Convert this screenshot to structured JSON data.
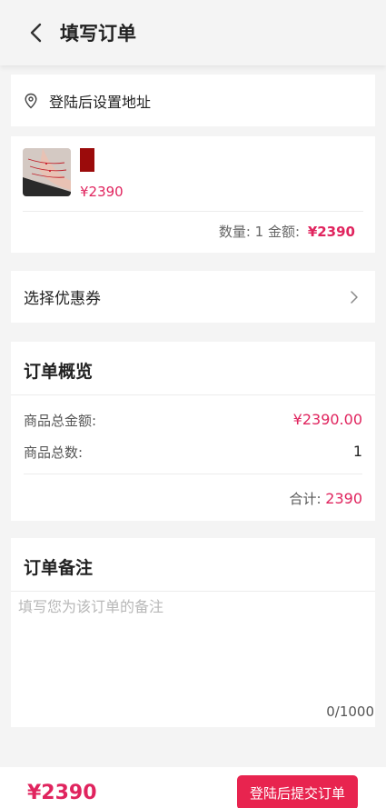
{
  "header": {
    "title": "填写订单",
    "back_icon": "chevron-left-icon"
  },
  "address": {
    "icon": "location-pin-icon",
    "text": "登陆后设置地址"
  },
  "product": {
    "swatch_color": "#9b0b0b",
    "price": "¥2390",
    "quantity_label": "数量: 1",
    "amount_label": "金额:",
    "amount_value": "¥2390"
  },
  "coupon": {
    "label": "选择优惠券",
    "icon": "chevron-right-icon"
  },
  "overview": {
    "title": "订单概览",
    "goods_total_label": "商品总金额:",
    "goods_total_value": "¥2390.00",
    "goods_count_label": "商品总数:",
    "goods_count_value": "1",
    "sum_label": "合计:",
    "sum_value": "2390"
  },
  "remark": {
    "title": "订单备注",
    "placeholder": "填写您为该订单的备注",
    "counter": "0/1000"
  },
  "bottom": {
    "total": "¥2390",
    "submit_label": "登陆后提交订单"
  },
  "colors": {
    "accent": "#e0245e",
    "button": "#e8244f",
    "background": "#f4f4f4"
  }
}
